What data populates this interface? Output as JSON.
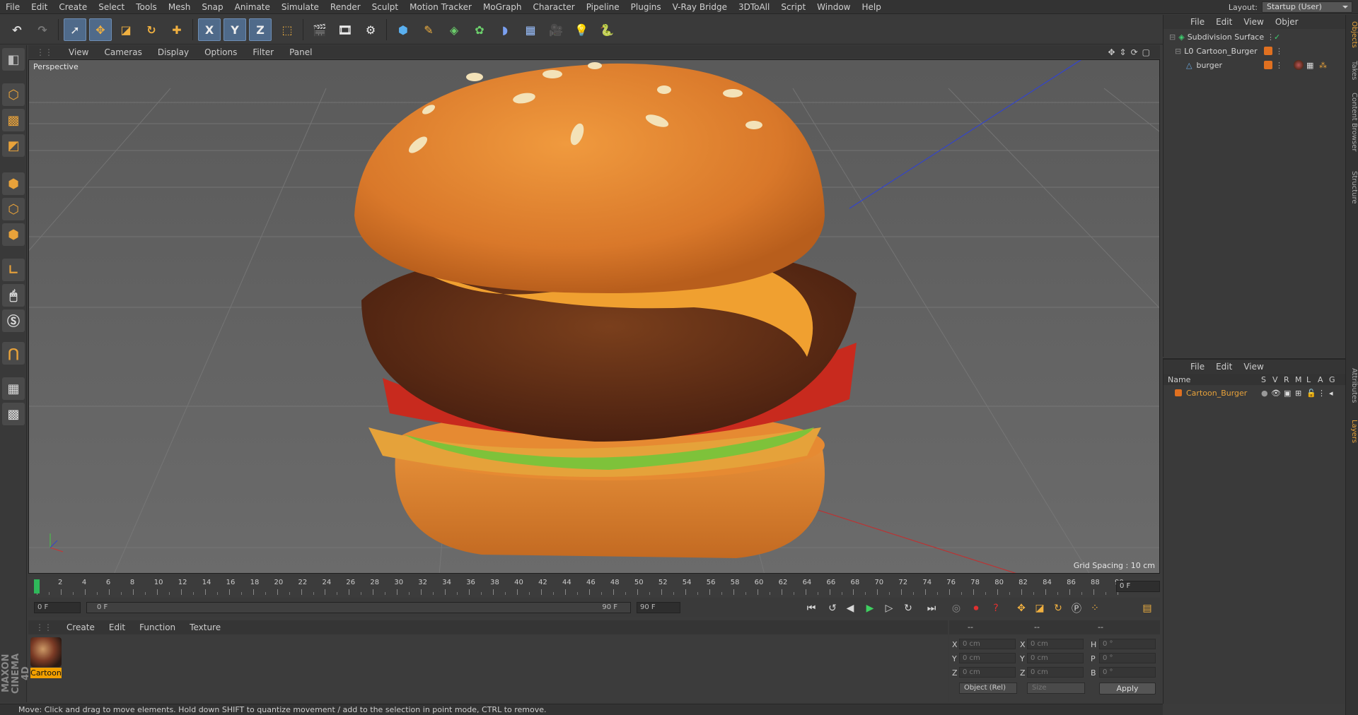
{
  "menubar": {
    "items": [
      "File",
      "Edit",
      "Create",
      "Select",
      "Tools",
      "Mesh",
      "Snap",
      "Animate",
      "Simulate",
      "Render",
      "Sculpt",
      "Motion Tracker",
      "MoGraph",
      "Character",
      "Pipeline",
      "Plugins",
      "V-Ray Bridge",
      "3DToAll",
      "Script",
      "Window",
      "Help"
    ],
    "layout_label": "Layout:",
    "layout_value": "Startup (User)"
  },
  "toolbar": {
    "icons": [
      "undo-icon",
      "redo-icon",
      "live-select-icon",
      "move-icon",
      "scale-icon",
      "rotate-icon",
      "recent-tool-icon",
      "x-axis-icon",
      "y-axis-icon",
      "z-axis-icon",
      "coordinate-system-icon",
      "render-view-icon",
      "render-picture-viewer-icon",
      "edit-render-settings-icon",
      "cube-icon",
      "pen-icon",
      "subdivision-icon",
      "cloner-icon",
      "deformer-icon",
      "floor-icon",
      "camera-icon",
      "light-icon",
      "python-icon"
    ],
    "axis_x": "X",
    "axis_y": "Y",
    "axis_z": "Z"
  },
  "viewport": {
    "menu": [
      "View",
      "Cameras",
      "Display",
      "Options",
      "Filter",
      "Panel"
    ],
    "label": "Perspective",
    "grid_spacing": "Grid Spacing : 10 cm"
  },
  "timeline": {
    "ticks": [
      "0",
      "2",
      "4",
      "6",
      "8",
      "10",
      "12",
      "14",
      "16",
      "18",
      "20",
      "22",
      "24",
      "26",
      "28",
      "30",
      "32",
      "34",
      "36",
      "38",
      "40",
      "42",
      "44",
      "46",
      "48",
      "50",
      "52",
      "54",
      "56",
      "58",
      "60",
      "62",
      "64",
      "66",
      "68",
      "70",
      "72",
      "74",
      "76",
      "78",
      "80",
      "82",
      "84",
      "86",
      "88",
      "90"
    ],
    "current_frame": "0 F",
    "start_field": "0 F",
    "range_start": "0 F",
    "range_end": "90 F",
    "end_field": "90 F"
  },
  "material_manager": {
    "menu": [
      "Create",
      "Edit",
      "Function",
      "Texture"
    ],
    "materials": [
      {
        "name": "Cartoon"
      }
    ]
  },
  "coordinates": {
    "header": [
      "--",
      "--",
      "--"
    ],
    "rows": [
      {
        "l1": "X",
        "v1": "0 cm",
        "l2": "X",
        "v2": "0 cm",
        "l3": "H",
        "v3": "0 °"
      },
      {
        "l1": "Y",
        "v1": "0 cm",
        "l2": "Y",
        "v2": "0 cm",
        "l3": "P",
        "v3": "0 °"
      },
      {
        "l1": "Z",
        "v1": "0 cm",
        "l2": "Z",
        "v2": "0 cm",
        "l3": "B",
        "v3": "0 °"
      }
    ],
    "mode_dropdown": "Object (Rel)",
    "size_dropdown": "Size",
    "apply_label": "Apply"
  },
  "status": "Move: Click and drag to move elements. Hold down SHIFT to quantize movement / add to the selection in point mode, CTRL to remove.",
  "object_manager": {
    "menu": [
      "File",
      "Edit",
      "View",
      "Objer"
    ],
    "objects": [
      {
        "name": "Subdivision Surface",
        "depth": 0
      },
      {
        "name": "Cartoon_Burger",
        "depth": 1
      },
      {
        "name": "burger",
        "depth": 2
      }
    ]
  },
  "layer_manager": {
    "menu": [
      "File",
      "Edit",
      "View"
    ],
    "columns": {
      "name": "Name",
      "flags": [
        "S",
        "V",
        "R",
        "M",
        "L",
        "A",
        "G"
      ]
    },
    "layers": [
      {
        "name": "Cartoon_Burger",
        "color": "#e07020"
      }
    ]
  },
  "side_tabs": [
    "Objects",
    "Takes",
    "Content Browser",
    "Structure",
    "Attributes",
    "Layers"
  ],
  "colors": {
    "accent": "#e8a23a",
    "active_tool": "#4f6a8a",
    "layer_orange": "#e07020"
  }
}
